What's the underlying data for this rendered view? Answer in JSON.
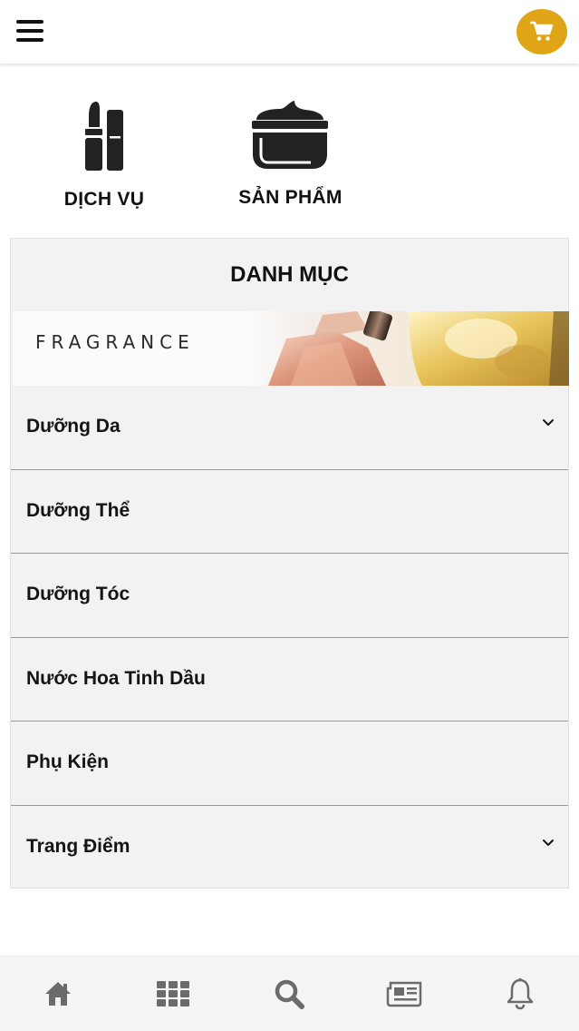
{
  "colors": {
    "accent": "#e0a516",
    "icon_dark": "#222222",
    "nav_icon": "#6b6b6b"
  },
  "header": {
    "menu_icon": "hamburger-menu-icon",
    "cart_icon": "shopping-cart-icon"
  },
  "tabs": [
    {
      "label": "DỊCH VỤ",
      "icon": "lipstick-icon",
      "active": false
    },
    {
      "label": "SẢN PHẨM",
      "icon": "cream-jar-icon",
      "active": true
    }
  ],
  "panel": {
    "title": "DANH MỤC",
    "banner_text": "FRAGRANCE",
    "categories": [
      {
        "label": "Dưỡng Da",
        "has_children": true
      },
      {
        "label": "Dưỡng Thể",
        "has_children": false
      },
      {
        "label": "Dưỡng Tóc",
        "has_children": false
      },
      {
        "label": "Nước Hoa Tinh Dầu",
        "has_children": false
      },
      {
        "label": "Phụ Kiện",
        "has_children": false
      },
      {
        "label": "Trang Điểm",
        "has_children": true
      }
    ]
  },
  "bottom_nav": [
    {
      "icon": "home-icon"
    },
    {
      "icon": "grid-icon"
    },
    {
      "icon": "search-icon"
    },
    {
      "icon": "news-icon"
    },
    {
      "icon": "bell-icon"
    }
  ]
}
